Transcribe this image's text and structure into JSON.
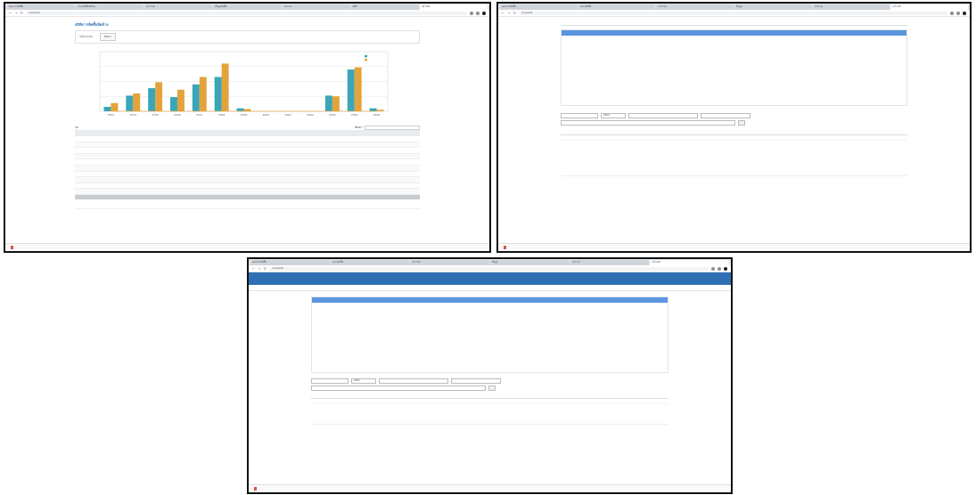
{
  "shot1": {
    "tabs": [
      "แผนการจัดซื้อ",
      "ระบบจัดซื้อจัดจ้าง",
      "ประกาศ",
      "ข้อมูลจัดซื้อ",
      "รายงาน",
      "สถิติ",
      "หน้าหลัก"
    ],
    "url": "ไม่ปลอดภัย",
    "title": "สถิติการจัดซื้อจัดจ้าง",
    "summary_label": "งบประมาณ ",
    "summary_value": "",
    "button": "ค้นหา",
    "table": {
      "length_label": "10",
      "search_label": "ค้นหา:",
      "headers": [
        "",
        "",
        "",
        ""
      ],
      "rows": [
        [
          "",
          "",
          "",
          ""
        ],
        [
          "",
          "",
          "",
          ""
        ],
        [
          "",
          "",
          "",
          ""
        ],
        [
          "",
          "",
          "",
          ""
        ],
        [
          "",
          "",
          "",
          ""
        ],
        [
          "",
          "",
          "",
          ""
        ],
        [
          "",
          "",
          "",
          ""
        ],
        [
          "",
          "",
          "",
          ""
        ],
        [
          "",
          "",
          "",
          ""
        ],
        [
          "",
          "",
          "",
          ""
        ]
      ],
      "footer": ""
    },
    "note": "",
    "note_link": "",
    "download_file": "",
    "show_all": ""
  },
  "chart_data": {
    "type": "bar",
    "categories": [
      "2553",
      "2554",
      "2555",
      "2556",
      "2557",
      "2558",
      "2559",
      "2560",
      "2561",
      "2562",
      "2563",
      "2564",
      "2565"
    ],
    "series": [
      {
        "name": "",
        "color": "#3aa6b9",
        "values": [
          12,
          42,
          62,
          38,
          72,
          92,
          8,
          0,
          0,
          0,
          42,
          112,
          8
        ]
      },
      {
        "name": "",
        "color": "#e3a33a",
        "values": [
          22,
          48,
          78,
          58,
          92,
          128,
          6,
          0,
          0,
          0,
          40,
          118,
          4
        ]
      }
    ],
    "line": {
      "color": "#e0aa52",
      "values": [
        0,
        0,
        0,
        0,
        0,
        0,
        0,
        0,
        0,
        0,
        0,
        0,
        0
      ]
    },
    "ylim": [
      0,
      160
    ],
    "grid": true,
    "legend": "top-right",
    "title": "",
    "xlabel": "",
    "ylabel": ""
  },
  "shot2": {
    "tabs": [
      "แผนการจัดซื้อ",
      "ระบบจัดซื้อ",
      "ประกาศ",
      "ข้อมูล",
      "รายงาน",
      "หน้าหลัก"
    ],
    "url": "ไม่ปลอดภัย",
    "menu": [
      "",
      "",
      ""
    ],
    "category_head": "",
    "columns": [
      {
        "head": "",
        "items": [
          "",
          ""
        ]
      },
      {
        "head": "",
        "items": [
          "",
          "",
          "",
          "",
          "",
          "",
          "",
          "",
          "",
          "",
          "",
          "",
          "",
          ""
        ]
      },
      {
        "head": "",
        "items": [
          "",
          "",
          "",
          "",
          "",
          "",
          "",
          "",
          "",
          "",
          "",
          "",
          "",
          ""
        ]
      },
      {
        "head": "",
        "items": [
          "",
          "",
          "",
          "",
          ""
        ]
      }
    ],
    "section": "",
    "filter_1": "",
    "filter_year": "2564",
    "filter_2": "",
    "filter_3": "",
    "filter_4": "",
    "go": "",
    "ann_group": "",
    "ann_group_meta": "",
    "ann_title": "",
    "ann_meta": "",
    "ann_lines": [
      "",
      "",
      "",
      "",
      ""
    ],
    "note": "",
    "note_link": "",
    "download_file": "",
    "show_all": ""
  },
  "shot3": {
    "tabs": [
      "แผนการจัดซื้อ",
      "ระบบจัดซื้อ",
      "ประกาศ",
      "ข้อมูล",
      "รายงาน",
      "หน้าหลัก"
    ],
    "url": "ไม่ปลอดภัย",
    "site_name": "",
    "site_right": "",
    "menu": [
      "",
      "",
      "",
      ""
    ],
    "category_head": "",
    "columns": [
      {
        "head": "",
        "items": [
          "",
          ""
        ]
      },
      {
        "head": "",
        "items": [
          "",
          "",
          "",
          "",
          "",
          "",
          "",
          "",
          "",
          "",
          "",
          "",
          "",
          ""
        ]
      },
      {
        "head": "",
        "items": [
          "",
          "",
          "",
          "",
          "",
          "",
          "",
          "",
          "",
          "",
          "",
          "",
          ""
        ]
      },
      {
        "head": "",
        "items": [
          "",
          "",
          "",
          "",
          "",
          ""
        ]
      }
    ],
    "section": "",
    "filter_1": "",
    "filter_year": "2564",
    "filter_2": "",
    "filter_3": "",
    "filter_4": "",
    "go": "",
    "ann_group": "",
    "ann_group_meta": "",
    "ann_title": "",
    "ann_meta": "",
    "ann_lines": [
      "",
      ""
    ],
    "note": "",
    "note_link": "",
    "download_file": "",
    "show_all": ""
  }
}
